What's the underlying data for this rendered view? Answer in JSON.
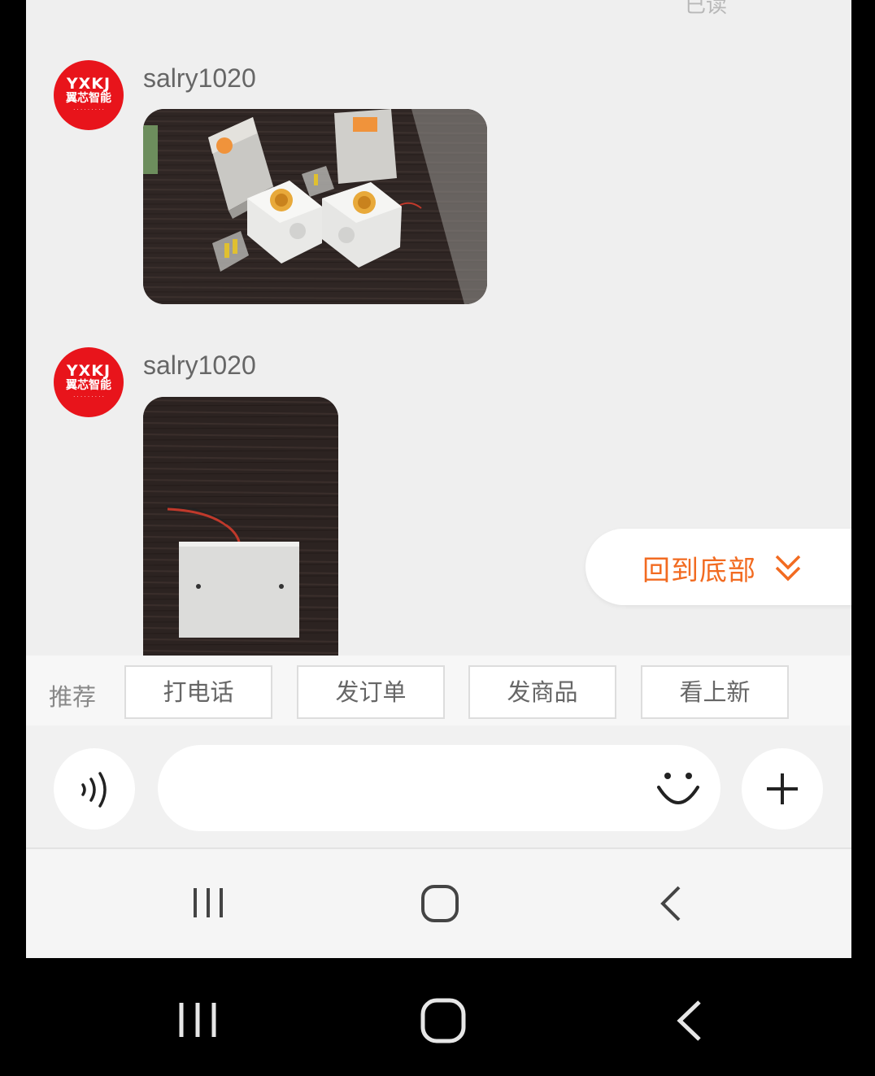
{
  "chat": {
    "read_status": "已读",
    "messages": [
      {
        "sender": "salry1020",
        "avatar_text": {
          "line1": "YXKJ",
          "line2": "翼芯智能"
        }
      },
      {
        "sender": "salry1020",
        "avatar_text": {
          "line1": "YXKJ",
          "line2": "翼芯智能"
        }
      }
    ]
  },
  "back_to_bottom": {
    "label": "回到底部",
    "color": "#f26b21"
  },
  "recommend": {
    "label": "推荐",
    "chips": [
      "打电话",
      "发订单",
      "发商品",
      "看上新"
    ]
  },
  "input_bar": {
    "voice_icon": "voice-icon",
    "emoji_icon": "smile-icon",
    "plus_icon": "plus-icon"
  },
  "nav": {
    "icons": [
      "recent-apps-icon",
      "home-icon",
      "back-icon"
    ]
  }
}
